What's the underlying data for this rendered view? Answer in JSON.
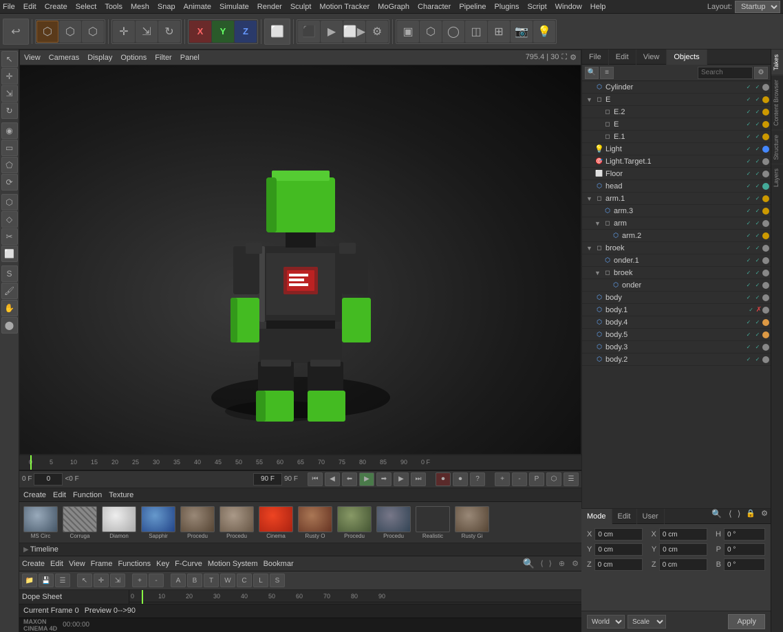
{
  "app": {
    "layout": "Startup",
    "title": "Cinema 4D"
  },
  "menubar": {
    "items": [
      "File",
      "Edit",
      "Create",
      "Select",
      "Tools",
      "Mesh",
      "Snap",
      "Animate",
      "Simulate",
      "Render",
      "Sculpt",
      "Motion Tracker",
      "MoGraph",
      "Character",
      "Pipeline",
      "Plugins",
      "Script",
      "Window",
      "Help"
    ]
  },
  "toolbar": {
    "groups": [
      "undo",
      "mode",
      "transform",
      "snap",
      "view",
      "render",
      "display"
    ]
  },
  "viewport": {
    "menus": [
      "View",
      "Cameras",
      "Display",
      "Options",
      "Filter",
      "Panel"
    ],
    "coords": "795.4 | 30"
  },
  "timeline": {
    "frame": "0 F",
    "start": "0",
    "end_preview": "90 F",
    "end_total": "90 F",
    "ticks": [
      "0",
      "5",
      "10",
      "15",
      "20",
      "25",
      "30",
      "35",
      "40",
      "45",
      "50",
      "55",
      "60",
      "65",
      "70",
      "75",
      "80",
      "85",
      "90"
    ]
  },
  "materials": {
    "header_menus": [
      "Create",
      "Edit",
      "Function",
      "Texture"
    ],
    "items": [
      {
        "name": "MS Circ",
        "color": "#6a8a9a"
      },
      {
        "name": "Corruga",
        "color": "#888"
      },
      {
        "name": "Diamon",
        "color": "#aaa"
      },
      {
        "name": "Sapphir",
        "color": "#4466aa"
      },
      {
        "name": "Procedu",
        "color": "#7a6a5a"
      },
      {
        "name": "Procedu",
        "color": "#887766"
      },
      {
        "name": "Cinema",
        "color": "#cc4422"
      },
      {
        "name": "Rusty O",
        "color": "#885533"
      },
      {
        "name": "Procedu",
        "color": "#667755"
      },
      {
        "name": "Procedu",
        "color": "#555566"
      },
      {
        "name": "Realistic",
        "color": "#778899"
      },
      {
        "name": "Rusty Gi",
        "color": "#776655"
      }
    ]
  },
  "timeline2": {
    "title": "Timeline",
    "header_menus": [
      "Create",
      "Edit",
      "View",
      "Frame",
      "Functions",
      "Key",
      "F-Curve",
      "Motion System",
      "Bookmar"
    ],
    "dope_sheet": "Dope Sheet",
    "current_frame": "Current Frame 0",
    "preview": "Preview 0-->90",
    "timecode": "00:00:00",
    "ruler_ticks": [
      "0",
      "10",
      "20",
      "30",
      "40",
      "50",
      "60",
      "70",
      "80",
      "90"
    ]
  },
  "objects_panel": {
    "tabs": [
      "File",
      "Edit",
      "View",
      "Objects"
    ],
    "search_placeholder": "Search",
    "items": [
      {
        "name": "Cylinder",
        "indent": 0,
        "icon": "cyl",
        "has_arrow": false,
        "flags": [
          "check",
          "check",
          "dot_grey"
        ]
      },
      {
        "name": "E",
        "indent": 0,
        "icon": "null",
        "has_arrow": true,
        "flags": [
          "check",
          "check",
          "dot_yellow"
        ]
      },
      {
        "name": "E.2",
        "indent": 1,
        "icon": "null",
        "has_arrow": false,
        "flags": [
          "check",
          "check",
          "dot_yellow"
        ]
      },
      {
        "name": "E",
        "indent": 1,
        "icon": "null",
        "has_arrow": false,
        "flags": [
          "check",
          "check",
          "dot_yellow"
        ]
      },
      {
        "name": "E.1",
        "indent": 1,
        "icon": "null",
        "has_arrow": false,
        "flags": [
          "check",
          "check",
          "dot_yellow"
        ]
      },
      {
        "name": "Light",
        "indent": 0,
        "icon": "light",
        "has_arrow": false,
        "flags": [
          "check",
          "check",
          "blue_dot"
        ]
      },
      {
        "name": "Light.Target.1",
        "indent": 0,
        "icon": "target",
        "has_arrow": false,
        "flags": [
          "check",
          "check",
          "dot_grey"
        ]
      },
      {
        "name": "Floor",
        "indent": 0,
        "icon": "floor",
        "has_arrow": false,
        "flags": [
          "check",
          "check",
          "dot_grey"
        ]
      },
      {
        "name": "head",
        "indent": 0,
        "icon": "mesh",
        "has_arrow": false,
        "flags": [
          "check",
          "check",
          "dot_green"
        ]
      },
      {
        "name": "arm.1",
        "indent": 0,
        "icon": "null",
        "has_arrow": true,
        "flags": [
          "check",
          "check",
          "dot_yellow"
        ]
      },
      {
        "name": "arm.3",
        "indent": 1,
        "icon": "mesh",
        "has_arrow": false,
        "flags": [
          "check",
          "check",
          "dot_yellow"
        ]
      },
      {
        "name": "arm",
        "indent": 1,
        "icon": "null",
        "has_arrow": true,
        "flags": [
          "check",
          "check",
          "dot_grey"
        ]
      },
      {
        "name": "arm.2",
        "indent": 2,
        "icon": "mesh",
        "has_arrow": false,
        "flags": [
          "check",
          "check",
          "dot_yellow"
        ]
      },
      {
        "name": "broek",
        "indent": 0,
        "icon": "null",
        "has_arrow": true,
        "flags": [
          "check",
          "check",
          "dot_grey"
        ]
      },
      {
        "name": "onder.1",
        "indent": 1,
        "icon": "mesh",
        "has_arrow": false,
        "flags": [
          "check",
          "check",
          "dot_grey"
        ]
      },
      {
        "name": "broek",
        "indent": 1,
        "icon": "null",
        "has_arrow": true,
        "flags": [
          "check",
          "check",
          "dot_grey"
        ]
      },
      {
        "name": "onder",
        "indent": 2,
        "icon": "mesh",
        "has_arrow": false,
        "flags": [
          "check",
          "check",
          "dot_grey"
        ]
      },
      {
        "name": "body",
        "indent": 0,
        "icon": "mesh",
        "has_arrow": false,
        "flags": [
          "check",
          "check",
          "dot_grey"
        ]
      },
      {
        "name": "body.1",
        "indent": 0,
        "icon": "mesh",
        "has_arrow": false,
        "flags": [
          "check",
          "x",
          "dot_grey"
        ]
      },
      {
        "name": "body.4",
        "indent": 0,
        "icon": "mesh",
        "has_arrow": false,
        "flags": [
          "check",
          "check",
          "dot_orange"
        ]
      },
      {
        "name": "body.5",
        "indent": 0,
        "icon": "mesh",
        "has_arrow": false,
        "flags": [
          "check",
          "check",
          "dot_orange"
        ]
      },
      {
        "name": "body.3",
        "indent": 0,
        "icon": "mesh",
        "has_arrow": false,
        "flags": [
          "check",
          "check",
          "dot_grey"
        ]
      },
      {
        "name": "body.2",
        "indent": 0,
        "icon": "mesh",
        "has_arrow": false,
        "flags": [
          "check",
          "check",
          "dot_grey"
        ]
      }
    ]
  },
  "attributes": {
    "tabs": [
      "Mode",
      "Edit",
      "User"
    ],
    "coords": {
      "x_label": "X",
      "x_val": "0 cm",
      "y_label": "Y",
      "y_val": "0 cm",
      "z_label": "Z",
      "z_val": "0 cm",
      "x2_label": "X",
      "x2_val": "0 cm",
      "y2_label": "Y",
      "y2_val": "0 cm",
      "z2_label": "Z",
      "z2_val": "0 cm",
      "h_label": "H",
      "h_val": "0 °",
      "p_label": "P",
      "p_val": "0 °",
      "b_label": "B",
      "b_val": "0 °"
    },
    "coord_system": "World",
    "transform_mode": "Scale",
    "apply_label": "Apply"
  },
  "side_tabs": [
    "Takes",
    "Content Browser",
    "Structure",
    "Layers"
  ]
}
